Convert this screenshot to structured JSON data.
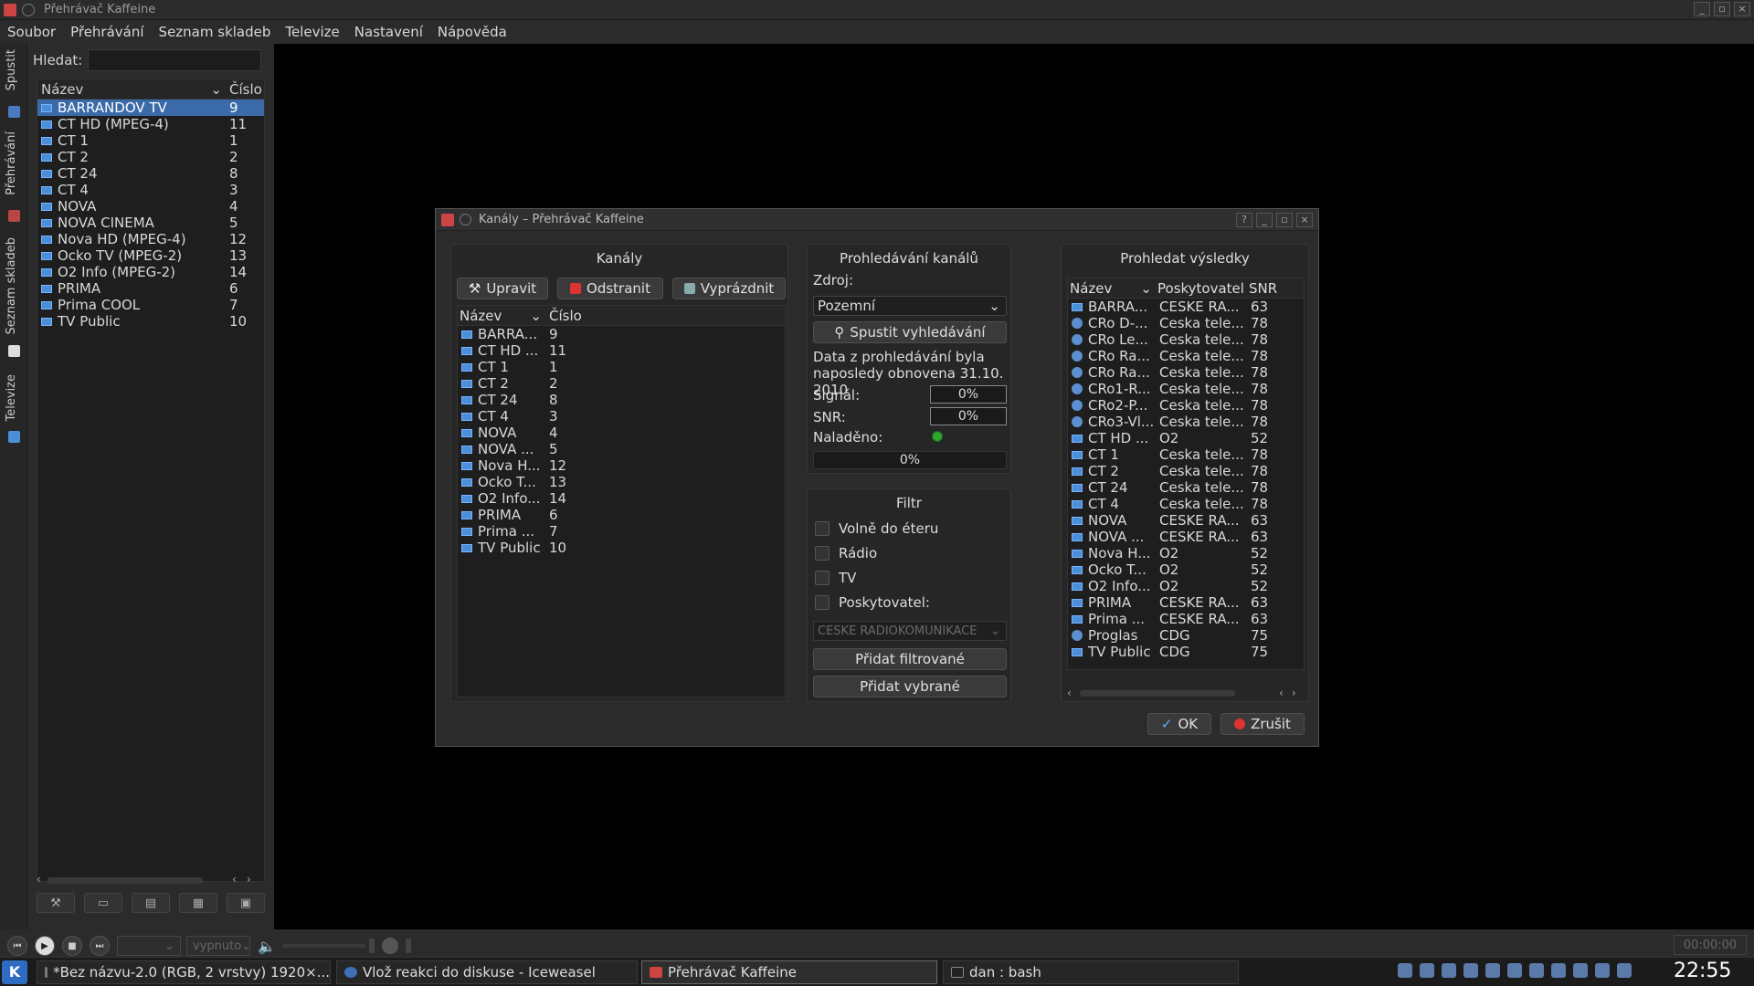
{
  "window": {
    "title": "Přehrávač Kaffeine",
    "buttons": [
      "_",
      "▫",
      "×"
    ]
  },
  "menu": [
    "Soubor",
    "Přehrávání",
    "Seznam skladeb",
    "Televize",
    "Nastavení",
    "Nápověda"
  ],
  "vtabs": [
    "Spustit",
    "Přehrávání",
    "Seznam skladeb",
    "Televize"
  ],
  "left": {
    "search_label": "Hledat:",
    "search_value": "",
    "col_name": "Název",
    "col_num": "Číslo",
    "channels": [
      {
        "name": "BARRANDOV TV",
        "num": "9"
      },
      {
        "name": "CT HD (MPEG-4)",
        "num": "11"
      },
      {
        "name": "CT 1",
        "num": "1"
      },
      {
        "name": "CT 2",
        "num": "2"
      },
      {
        "name": "CT 24",
        "num": "8"
      },
      {
        "name": "CT 4",
        "num": "3"
      },
      {
        "name": " NOVA",
        "num": "4"
      },
      {
        "name": "NOVA CINEMA",
        "num": "5"
      },
      {
        "name": "Nova HD (MPEG-4)",
        "num": "12"
      },
      {
        "name": "Ocko TV (MPEG-2)",
        "num": "13"
      },
      {
        "name": "O2 Info (MPEG-2)",
        "num": "14"
      },
      {
        "name": "PRIMA",
        "num": "6"
      },
      {
        "name": "Prima COOL",
        "num": "7"
      },
      {
        "name": "TV Public",
        "num": "10"
      }
    ]
  },
  "controls": {
    "audio_select": "",
    "subtitle_select": "vypnuto",
    "time": "00:00:00"
  },
  "taskbar": {
    "tasks": [
      "*Bez názvu-2.0 (RGB, 2 vrstvy) 1920×...",
      "Vlož reakci do diskuse - Iceweasel",
      "Přehrávač Kaffeine",
      "dan : bash"
    ],
    "clock": "22:55"
  },
  "dialog": {
    "title": "Kanály – Přehrávač Kaffeine",
    "title_buttons": [
      "?",
      "_",
      "▫",
      "×"
    ],
    "channels": {
      "title": "Kanály",
      "edit": "Upravit",
      "remove": "Odstranit",
      "clear": "Vyprázdnit",
      "col_name": "Název",
      "col_num": "Číslo",
      "rows": [
        {
          "name": "BARRA...",
          "num": "9"
        },
        {
          "name": "CT HD ...",
          "num": "11"
        },
        {
          "name": "CT 1",
          "num": "1"
        },
        {
          "name": "CT 2",
          "num": "2"
        },
        {
          "name": "CT 24",
          "num": "8"
        },
        {
          "name": "CT 4",
          "num": "3"
        },
        {
          "name": " NOVA",
          "num": "4"
        },
        {
          "name": "NOVA ...",
          "num": "5"
        },
        {
          "name": "Nova H...",
          "num": "12"
        },
        {
          "name": "Ocko T...",
          "num": "13"
        },
        {
          "name": "O2 Info...",
          "num": "14"
        },
        {
          "name": "PRIMA",
          "num": "6"
        },
        {
          "name": "Prima ...",
          "num": "7"
        },
        {
          "name": "TV Public",
          "num": "10"
        }
      ]
    },
    "scan": {
      "title": "Prohledávání kanálů",
      "source_label": "Zdroj:",
      "source_value": "Pozemní",
      "start": "Spustit vyhledávání",
      "info": "Data z prohledávání byla naposledy obnovena 31.10. 2010",
      "signal_label": "Signál:",
      "signal": "0%",
      "snr_label": "SNR:",
      "snr": "0%",
      "tuned_label": "Naladěno:",
      "progress": "0%"
    },
    "filter": {
      "title": "Filtr",
      "fta": "Volně do éteru",
      "radio": "Rádio",
      "tv": "TV",
      "provider": "Poskytovatel:",
      "provider_value": "CESKE RADIOKOMUNIKACE",
      "add_filtered": "Přidat filtrované",
      "add_selected": "Přidat vybrané"
    },
    "results": {
      "title": "Prohledat výsledky",
      "col_name": "Název",
      "col_provider": "Poskytovatel",
      "col_snr": "SNR",
      "rows": [
        {
          "name": "BARRA...",
          "provider": "CESKE RA...",
          "snr": "63",
          "type": "tv"
        },
        {
          "name": "CRo D-...",
          "provider": "Ceska tele...",
          "snr": "78",
          "type": "radio"
        },
        {
          "name": "CRo Le...",
          "provider": "Ceska tele...",
          "snr": "78",
          "type": "radio"
        },
        {
          "name": "CRo Ra...",
          "provider": "Ceska tele...",
          "snr": "78",
          "type": "radio"
        },
        {
          "name": "CRo Ra...",
          "provider": "Ceska tele...",
          "snr": "78",
          "type": "radio"
        },
        {
          "name": "CRo1-R...",
          "provider": "Ceska tele...",
          "snr": "78",
          "type": "radio"
        },
        {
          "name": "CRo2-P...",
          "provider": "Ceska tele...",
          "snr": "78",
          "type": "radio"
        },
        {
          "name": "CRo3-Vl...",
          "provider": "Ceska tele...",
          "snr": "78",
          "type": "radio"
        },
        {
          "name": "CT HD ...",
          "provider": "O2",
          "snr": "52",
          "type": "tv"
        },
        {
          "name": "CT 1",
          "provider": "Ceska tele...",
          "snr": "78",
          "type": "tv"
        },
        {
          "name": "CT 2",
          "provider": "Ceska tele...",
          "snr": "78",
          "type": "tv"
        },
        {
          "name": "CT 24",
          "provider": "Ceska tele...",
          "snr": "78",
          "type": "tv"
        },
        {
          "name": "CT 4",
          "provider": "Ceska tele...",
          "snr": "78",
          "type": "tv"
        },
        {
          "name": " NOVA",
          "provider": "CESKE RA...",
          "snr": "63",
          "type": "tv"
        },
        {
          "name": "NOVA ...",
          "provider": "CESKE RA...",
          "snr": "63",
          "type": "tv"
        },
        {
          "name": "Nova H...",
          "provider": "O2",
          "snr": "52",
          "type": "tv"
        },
        {
          "name": "Ocko T...",
          "provider": "O2",
          "snr": "52",
          "type": "tv"
        },
        {
          "name": "O2 Info...",
          "provider": "O2",
          "snr": "52",
          "type": "tv"
        },
        {
          "name": "PRIMA",
          "provider": "CESKE RA...",
          "snr": "63",
          "type": "tv"
        },
        {
          "name": "Prima ...",
          "provider": "CESKE RA...",
          "snr": "63",
          "type": "tv"
        },
        {
          "name": "Proglas",
          "provider": "CDG",
          "snr": "75",
          "type": "radio"
        },
        {
          "name": "TV Public",
          "provider": "CDG",
          "snr": "75",
          "type": "tv"
        }
      ]
    },
    "ok": "OK",
    "cancel": "Zrušit"
  }
}
